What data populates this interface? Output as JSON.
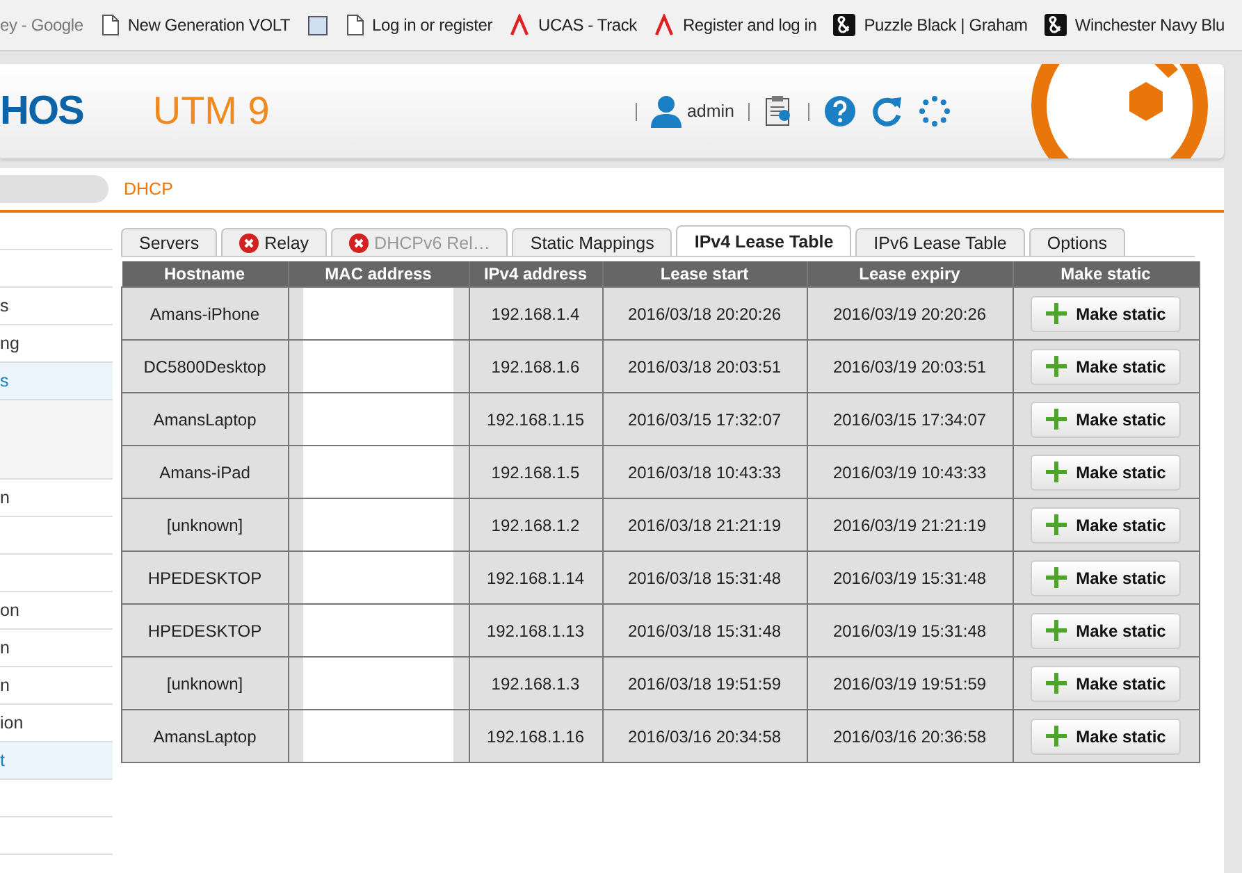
{
  "bookmarks": [
    {
      "kind": "faded",
      "label": "ey - Google"
    },
    {
      "kind": "page",
      "label": "New Generation VOLT"
    },
    {
      "kind": "square"
    },
    {
      "kind": "page",
      "label": "Log in or register"
    },
    {
      "kind": "lambda",
      "label": "UCAS - Track"
    },
    {
      "kind": "lambda",
      "label": "Register and log in"
    },
    {
      "kind": "amp",
      "label": "Puzzle Black | Graham"
    },
    {
      "kind": "amp",
      "label": "Winchester Navy Blu"
    }
  ],
  "header": {
    "logo_text": "HOS",
    "product": "UTM 9",
    "user": "admin"
  },
  "breadcrumb": "DHCP",
  "sidebar": {
    "items": [
      {
        "active": false
      },
      {
        "active": false
      },
      {
        "label": "s",
        "active": false
      },
      {
        "label": "ng",
        "active": false
      },
      {
        "label": "s",
        "active": true,
        "expanded": true
      },
      {
        "label": "n",
        "active": false
      },
      {
        "active": false
      },
      {
        "active": false
      },
      {
        "label": "on",
        "active": false
      },
      {
        "label": "n",
        "active": false
      },
      {
        "label": "n",
        "active": false
      },
      {
        "label": "ion",
        "active": false
      },
      {
        "label": "t",
        "active": true
      },
      {
        "active": false
      },
      {
        "active": false
      }
    ]
  },
  "tabs": [
    {
      "label": "Servers",
      "selected": false,
      "disabled": false
    },
    {
      "label": "Relay",
      "selected": false,
      "disabled": false,
      "error": true
    },
    {
      "label": "DHCPv6 Rel…",
      "selected": false,
      "disabled": true,
      "error": true
    },
    {
      "label": "Static Mappings",
      "selected": false,
      "disabled": false
    },
    {
      "label": "IPv4 Lease Table",
      "selected": true,
      "disabled": false
    },
    {
      "label": "IPv6 Lease Table",
      "selected": false,
      "disabled": false
    },
    {
      "label": "Options",
      "selected": false,
      "disabled": false
    }
  ],
  "table": {
    "columns": [
      "Hostname",
      "MAC address",
      "IPv4 address",
      "Lease start",
      "Lease expiry",
      "Make static"
    ],
    "rows": [
      {
        "hostname": "Amans-iPhone",
        "ipv4": "192.168.1.4",
        "lease_start": "2016/03/18 20:20:26",
        "lease_expiry": "2016/03/19 20:20:26",
        "action": "Make static"
      },
      {
        "hostname": "DC5800Desktop",
        "ipv4": "192.168.1.6",
        "lease_start": "2016/03/18 20:03:51",
        "lease_expiry": "2016/03/19 20:03:51",
        "action": "Make static"
      },
      {
        "hostname": "AmansLaptop",
        "ipv4": "192.168.1.15",
        "lease_start": "2016/03/15 17:32:07",
        "lease_expiry": "2016/03/15 17:34:07",
        "action": "Make static"
      },
      {
        "hostname": "Amans-iPad",
        "ipv4": "192.168.1.5",
        "lease_start": "2016/03/18 10:43:33",
        "lease_expiry": "2016/03/19 10:43:33",
        "action": "Make static"
      },
      {
        "hostname": "[unknown]",
        "ipv4": "192.168.1.2",
        "lease_start": "2016/03/18 21:21:19",
        "lease_expiry": "2016/03/19 21:21:19",
        "action": "Make static"
      },
      {
        "hostname": "HPEDESKTOP",
        "ipv4": "192.168.1.14",
        "lease_start": "2016/03/18 15:31:48",
        "lease_expiry": "2016/03/19 15:31:48",
        "action": "Make static"
      },
      {
        "hostname": "HPEDESKTOP",
        "ipv4": "192.168.1.13",
        "lease_start": "2016/03/18 15:31:48",
        "lease_expiry": "2016/03/19 15:31:48",
        "action": "Make static"
      },
      {
        "hostname": "[unknown]",
        "ipv4": "192.168.1.3",
        "lease_start": "2016/03/18 19:51:59",
        "lease_expiry": "2016/03/19 19:51:59",
        "action": "Make static"
      },
      {
        "hostname": "AmansLaptop",
        "ipv4": "192.168.1.16",
        "lease_start": "2016/03/16 20:34:58",
        "lease_expiry": "2016/03/16 20:36:58",
        "action": "Make static"
      }
    ]
  }
}
